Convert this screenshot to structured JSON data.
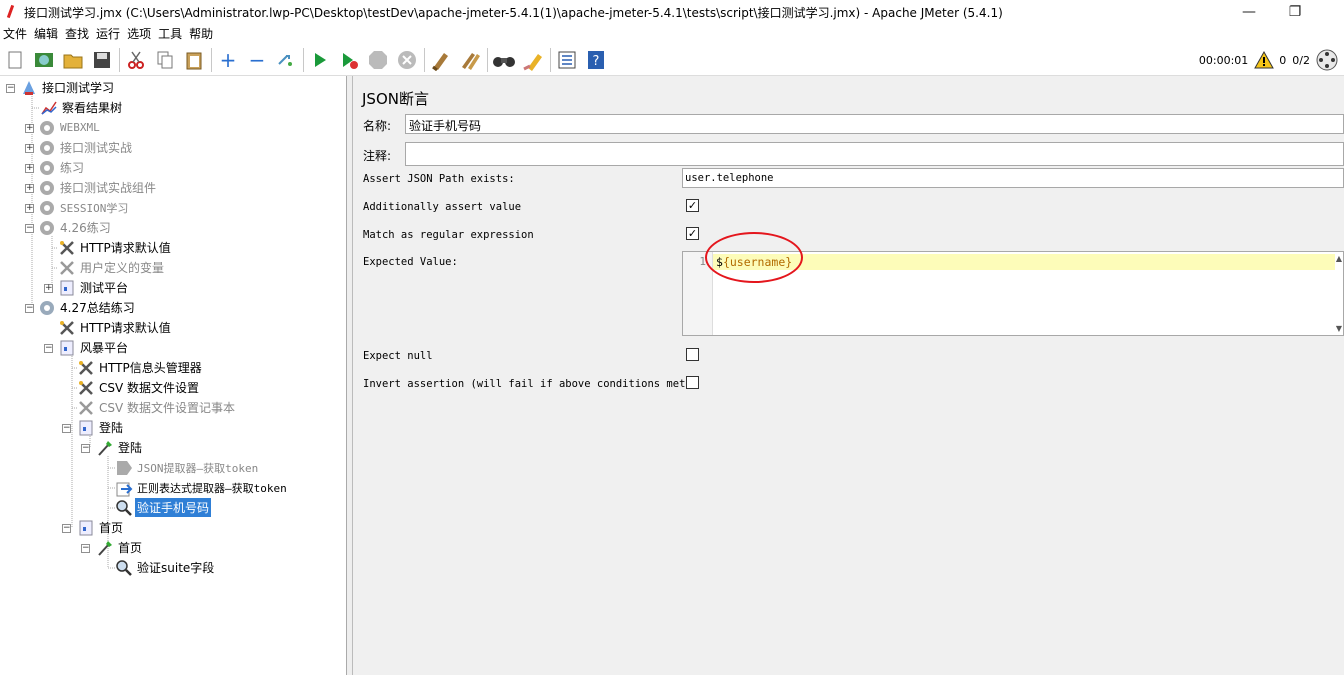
{
  "window": {
    "title": "接口测试学习.jmx (C:\\Users\\Administrator.lwp-PC\\Desktop\\testDev\\apache-jmeter-5.4.1(1)\\apache-jmeter-5.4.1\\tests\\script\\接口测试学习.jmx) - Apache JMeter (5.4.1)",
    "minimize": "—",
    "maximize": "❐"
  },
  "menu": [
    "文件",
    "编辑",
    "查找",
    "运行",
    "选项",
    "工具",
    "帮助"
  ],
  "toolbar": {
    "icons": [
      "new-icon",
      "templates-icon",
      "open-icon",
      "save-icon",
      "cut-icon",
      "copy-icon",
      "paste-icon",
      "expand-icon",
      "collapse-icon",
      "toggle-icon",
      "start-icon",
      "start-no-pause-icon",
      "stop-icon",
      "shutdown-icon",
      "clear-icon",
      "clear-all-icon",
      "search-icon",
      "reset-search-icon",
      "function-helper-icon",
      "help-icon"
    ],
    "elapsed_time": "00:00:01",
    "warning_count": "0",
    "threads": "0/2"
  },
  "tree": {
    "nodes": [
      {
        "label": "接口测试学习",
        "icon": "test-plan-icon",
        "state": "normal"
      },
      {
        "label": "察看结果树",
        "icon": "listener-icon",
        "state": "normal"
      },
      {
        "label": "WEBXML",
        "icon": "thread-group-icon",
        "state": "disabled"
      },
      {
        "label": "接口测试实战",
        "icon": "thread-group-icon",
        "state": "disabled"
      },
      {
        "label": "练习",
        "icon": "thread-group-icon",
        "state": "disabled"
      },
      {
        "label": "接口测试实战组件",
        "icon": "thread-group-icon",
        "state": "disabled"
      },
      {
        "label": "SESSION学习",
        "icon": "thread-group-icon",
        "state": "disabled"
      },
      {
        "label": "4.26练习",
        "icon": "thread-group-icon",
        "state": "disabled"
      },
      {
        "label": "HTTP请求默认值",
        "icon": "config-element-icon",
        "state": "normal"
      },
      {
        "label": "用户定义的变量",
        "icon": "config-element-icon",
        "state": "disabled"
      },
      {
        "label": "测试平台",
        "icon": "controller-icon",
        "state": "normal"
      },
      {
        "label": "4.27总结练习",
        "icon": "thread-group-icon",
        "state": "normal"
      },
      {
        "label": "HTTP请求默认值",
        "icon": "config-element-icon",
        "state": "normal"
      },
      {
        "label": "风暴平台",
        "icon": "controller-icon",
        "state": "normal"
      },
      {
        "label": "HTTP信息头管理器",
        "icon": "config-element-icon",
        "state": "normal"
      },
      {
        "label": "CSV 数据文件设置",
        "icon": "config-element-icon",
        "state": "normal"
      },
      {
        "label": "CSV 数据文件设置记事本",
        "icon": "config-element-icon",
        "state": "disabled"
      },
      {
        "label": "登陆",
        "icon": "controller-icon",
        "state": "normal"
      },
      {
        "label": "登陆",
        "icon": "sampler-icon",
        "state": "normal"
      },
      {
        "label": "JSON提取器—获取token",
        "icon": "extractor-icon",
        "state": "disabled"
      },
      {
        "label": "正则表达式提取器—获取token",
        "icon": "regex-extractor-icon",
        "state": "normal"
      },
      {
        "label": "验证手机号码",
        "icon": "assertion-icon",
        "state": "selected"
      },
      {
        "label": "首页",
        "icon": "controller-icon",
        "state": "normal"
      },
      {
        "label": "首页",
        "icon": "sampler-icon",
        "state": "normal"
      },
      {
        "label": "验证suite字段",
        "icon": "assertion-icon",
        "state": "normal"
      }
    ]
  },
  "panel": {
    "title": "JSON断言",
    "name_label": "名称:",
    "name_value": "验证手机号码",
    "comment_label": "注释:",
    "comment_value": "",
    "json_path_label": "Assert JSON Path exists:",
    "json_path_value": "user.telephone",
    "assert_value_label": "Additionally assert value",
    "assert_value_checked": true,
    "regex_label": "Match as regular expression",
    "regex_checked": true,
    "expected_label": "Expected Value:",
    "expected_line_no": "1",
    "expected_prefix": "$",
    "expected_value": "{username}",
    "expect_null_label": "Expect null",
    "expect_null_checked": false,
    "invert_label": "Invert assertion (will fail if above conditions met)",
    "invert_checked": false
  }
}
